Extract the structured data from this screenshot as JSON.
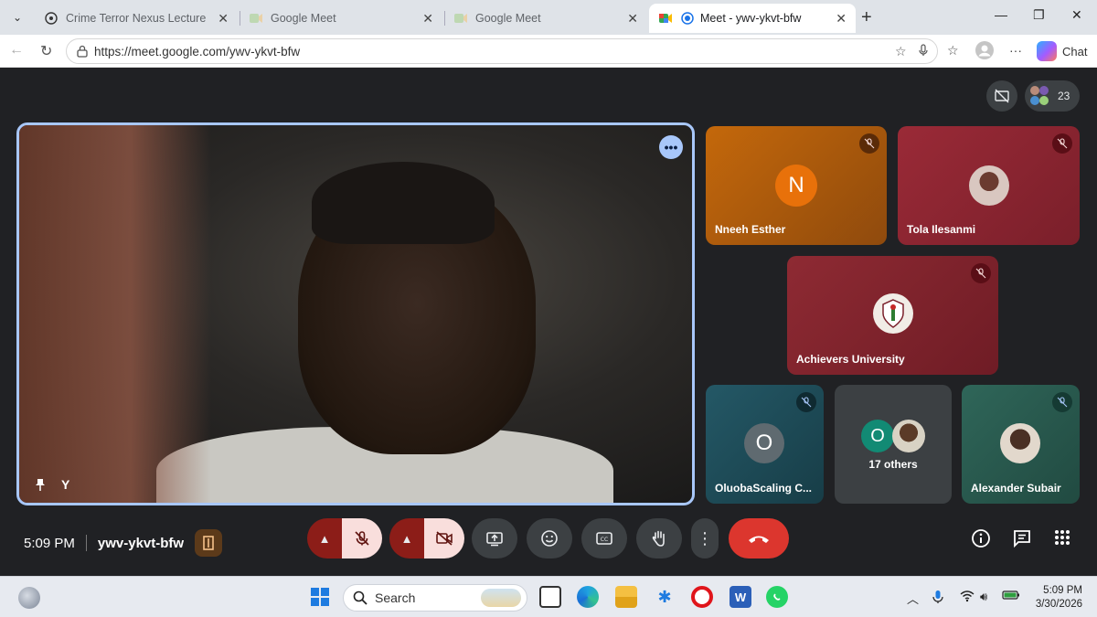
{
  "browser": {
    "tabs": [
      {
        "title": "Crime Terror Nexus Lecture",
        "active": false
      },
      {
        "title": "Google Meet",
        "active": false
      },
      {
        "title": "Google Meet",
        "active": false
      },
      {
        "title": "Meet - ywv-ykvt-bfw",
        "active": true
      }
    ],
    "url": "https://meet.google.com/ywv-ykvt-bfw",
    "chat_label": "Chat"
  },
  "meet": {
    "participant_count": "23",
    "main_tile": {
      "label": "Y"
    },
    "participants": [
      {
        "name": "Nneeh Esther",
        "initial": "N",
        "avatar_color": "#e8710a",
        "bg": "#b45a0a"
      },
      {
        "name": "Tola Ilesanmi",
        "bg": "#8c2331"
      },
      {
        "name": "Achievers University",
        "bg": "#7d2229"
      },
      {
        "name": "OluobaScaling C...",
        "initial": "O",
        "avatar_color": "#5f6a70",
        "bg": "#1f4a55"
      },
      {
        "name": "17 others",
        "initial": "O",
        "avatar_color": "#128a74",
        "bg": "#3c4043"
      },
      {
        "name": "Alexander Subair",
        "bg": "#2b5a52"
      }
    ],
    "time": "5:09 PM",
    "meeting_code": "ywv-ykvt-bfw"
  },
  "taskbar": {
    "search_placeholder": "Search",
    "clock_time": "5:09 PM",
    "clock_date": "3/30/2026"
  },
  "colors": {
    "accent": "#a8c7fa",
    "leave_red": "#dc362e",
    "mute_red": "#8c1d18"
  }
}
